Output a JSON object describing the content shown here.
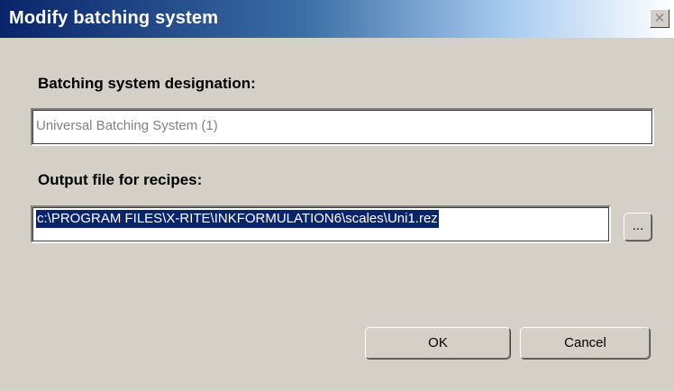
{
  "window": {
    "title": "Modify batching system",
    "close_glyph": "✕"
  },
  "designation": {
    "label": "Batching system designation:",
    "value": "Universal Batching System (1)"
  },
  "output": {
    "label": "Output file for recipes:",
    "value": "c:\\PROGRAM FILES\\X-RITE\\INKFORMULATION6\\scales\\Uni1.rez",
    "browse_label": "..."
  },
  "buttons": {
    "ok": "OK",
    "cancel": "Cancel"
  },
  "colors": {
    "title_bar_start": "#0a246a",
    "selection": "#0a246a",
    "dialog_face": "#d4d0c8"
  },
  "icons": {
    "close": "close-icon"
  }
}
